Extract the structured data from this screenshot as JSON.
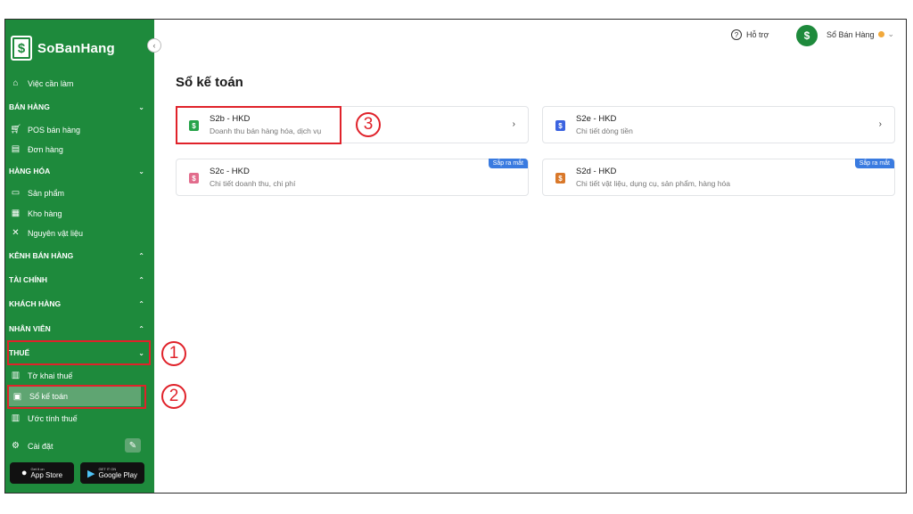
{
  "brand": {
    "name": "SoBanHang",
    "logo_glyph": "$"
  },
  "sidebar": {
    "collapse_glyph": "‹",
    "todo": {
      "label": "Việc cần làm",
      "icon": "home-icon"
    },
    "sections": [
      {
        "title": "BÁN HÀNG",
        "expanded": true
      },
      {
        "title": "HÀNG HÓA",
        "expanded": true
      },
      {
        "title": "KÊNH BÁN HÀNG",
        "expanded": false
      },
      {
        "title": "TÀI CHÍNH",
        "expanded": false
      },
      {
        "title": "KHÁCH HÀNG",
        "expanded": false
      },
      {
        "title": "NHÂN VIÊN",
        "expanded": false
      },
      {
        "title": "THUẾ",
        "expanded": true
      }
    ],
    "items": {
      "pos": "POS bán hàng",
      "orders": "Đơn hàng",
      "products": "Sản phẩm",
      "warehouse": "Kho hàng",
      "materials": "Nguyên vật liệu",
      "tax_declaration": "Tờ khai thuế",
      "accounting_book": "Sổ kế toán",
      "tax_estimate": "Ước tính thuế",
      "settings": "Cài đặt"
    },
    "chev_down": "⌄",
    "chev_up": "⌃"
  },
  "stores": {
    "appstore_small": "Get it on",
    "appstore": "App Store",
    "googleplay_small": "GET IT ON",
    "googleplay": "Google Play"
  },
  "topbar": {
    "help_label": "Hỗ trợ",
    "help_glyph": "?",
    "user_name": "Sổ Bán Hàng",
    "avatar_glyph": "$",
    "dropdown_glyph": "⌄"
  },
  "main": {
    "title": "Sổ kế toán",
    "cards": [
      {
        "title": "S2b - HKD",
        "subtitle": "Doanh thu bán hàng hóa, dịch vụ",
        "icon_color": "#27a34a",
        "badge": "",
        "arrow": "›"
      },
      {
        "title": "S2e - HKD",
        "subtitle": "Chi tiết dòng tiền",
        "icon_color": "#3b63e0",
        "badge": "",
        "arrow": "›"
      },
      {
        "title": "S2c - HKD",
        "subtitle": "Chi tiết doanh thu, chi phí",
        "icon_color": "#e26c8c",
        "badge": "Sắp ra mắt",
        "arrow": ""
      },
      {
        "title": "S2d - HKD",
        "subtitle": "Chi tiết vật liệu, dụng cụ, sản phẩm, hàng hóa",
        "icon_color": "#d9782a",
        "badge": "Sắp ra mắt",
        "arrow": ""
      }
    ]
  },
  "annotations": {
    "m1": "1",
    "m2": "2",
    "m3": "3"
  },
  "colors": {
    "sidebar": "#1e8a3c",
    "highlight": "#e0222a",
    "badge": "#3a7be0"
  }
}
